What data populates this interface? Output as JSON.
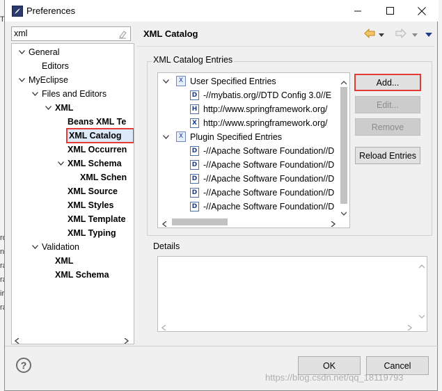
{
  "window": {
    "title": "Preferences"
  },
  "filter": {
    "value": "xml"
  },
  "tree": [
    {
      "label": "General",
      "bold": false,
      "twisty": "down",
      "level": 0
    },
    {
      "label": "Editors",
      "bold": false,
      "twisty": "",
      "level": 1
    },
    {
      "label": "MyEclipse",
      "bold": false,
      "twisty": "down",
      "level": 0
    },
    {
      "label": "Files and Editors",
      "bold": false,
      "twisty": "down",
      "level": 1
    },
    {
      "label": "XML",
      "bold": true,
      "twisty": "down",
      "level": 2
    },
    {
      "label": "Beans XML Te",
      "bold": true,
      "twisty": "",
      "level": 3
    },
    {
      "label": "XML Catalog",
      "bold": true,
      "twisty": "",
      "level": 3,
      "selected": true
    },
    {
      "label": "XML Occurren",
      "bold": true,
      "twisty": "",
      "level": 3
    },
    {
      "label": "XML Schema",
      "bold": true,
      "twisty": "down",
      "level": 3
    },
    {
      "label": "XML Schen",
      "bold": true,
      "twisty": "",
      "level": 4
    },
    {
      "label": "XML Source",
      "bold": true,
      "twisty": "",
      "level": 3
    },
    {
      "label": "XML Styles",
      "bold": true,
      "twisty": "",
      "level": 3
    },
    {
      "label": "XML Template",
      "bold": true,
      "twisty": "",
      "level": 3
    },
    {
      "label": "XML Typing",
      "bold": true,
      "twisty": "",
      "level": 3
    },
    {
      "label": "Validation",
      "bold": false,
      "twisty": "down",
      "level": 1
    },
    {
      "label": "XML",
      "bold": true,
      "twisty": "",
      "level": 2
    },
    {
      "label": "XML Schema",
      "bold": true,
      "twisty": "",
      "level": 2
    }
  ],
  "page": {
    "title": "XML Catalog",
    "entries_group_label": "XML Catalog Entries",
    "details_label": "Details"
  },
  "catalog": [
    {
      "label": "User Specified Entries",
      "kind": "group",
      "level": 0
    },
    {
      "label": "-//mybatis.org//DTD Config 3.0//E",
      "kind": "D",
      "level": 1
    },
    {
      "label": "http://www.springframework.org/",
      "kind": "H",
      "level": 1
    },
    {
      "label": "http://www.springframework.org/",
      "kind": "X",
      "level": 1
    },
    {
      "label": "Plugin Specified Entries",
      "kind": "group",
      "level": 0
    },
    {
      "label": "-//Apache Software Foundation//D",
      "kind": "D",
      "level": 1
    },
    {
      "label": "-//Apache Software Foundation//D",
      "kind": "D",
      "level": 1
    },
    {
      "label": "-//Apache Software Foundation//D",
      "kind": "D",
      "level": 1
    },
    {
      "label": "-//Apache Software Foundation//D",
      "kind": "D",
      "level": 1
    },
    {
      "label": "-//Apache Software Foundation//D",
      "kind": "D",
      "level": 1
    }
  ],
  "buttons": {
    "add": "Add...",
    "edit": "Edit...",
    "remove": "Remove",
    "reload": "Reload Entries",
    "ok": "OK",
    "cancel": "Cancel"
  },
  "watermark": "https://blog.csdn.net/qq_18119793",
  "colors": {
    "highlight": "#e53935",
    "selection": "#dbe9f9",
    "nav_arrow": "#d99a1e"
  }
}
